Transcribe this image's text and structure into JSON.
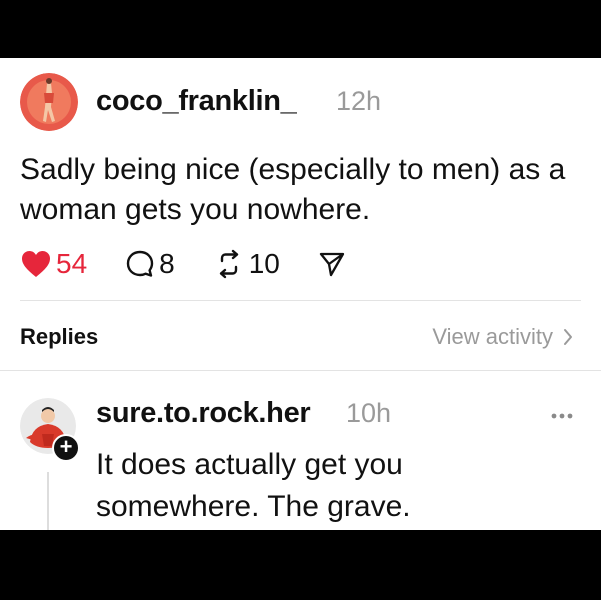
{
  "post": {
    "username": "coco_franklin_",
    "time": "12h",
    "text": "Sadly being nice (especially to men) as a woman gets you nowhere.",
    "likes": "54",
    "comments": "8",
    "reposts": "10",
    "liked": true
  },
  "replies_section": {
    "label": "Replies",
    "view_activity": "View activity"
  },
  "reply": {
    "username": "sure.to.rock.her",
    "time": "10h",
    "text": "It does actually get you somewhere.  The grave.",
    "follow_symbol": "+"
  },
  "colors": {
    "like_red": "#e6263b",
    "muted_gray": "#9a9a9a"
  },
  "icons": [
    "heart-icon",
    "comment-icon",
    "repost-icon",
    "share-icon",
    "chevron-right-icon",
    "more-icon",
    "plus-icon"
  ]
}
